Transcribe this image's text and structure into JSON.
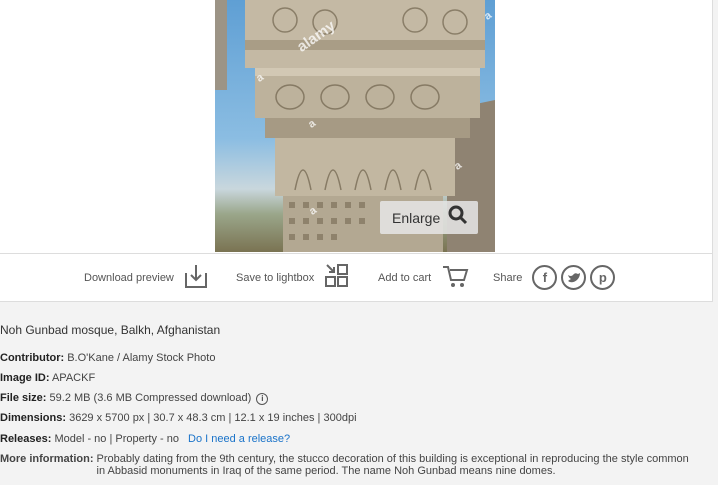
{
  "image": {
    "alt": "",
    "watermarks": [
      "alamy",
      "a",
      "a",
      "a",
      "a",
      "a"
    ]
  },
  "enlarge_label": "Enlarge",
  "actions": {
    "download_preview": "Download preview",
    "save_to_lightbox": "Save to lightbox",
    "add_to_cart": "Add to cart",
    "share": "Share",
    "share_icons": [
      "facebook-icon",
      "twitter-icon",
      "pinterest-icon"
    ]
  },
  "details": {
    "title": "Noh Gunbad mosque, Balkh, Afghanistan",
    "contributor_label": "Contributor:",
    "contributor": "B.O'Kane / Alamy Stock Photo",
    "image_id_label": "Image ID:",
    "image_id": "APACKF",
    "file_size_label": "File size:",
    "file_size": "59.2 MB (3.6 MB Compressed download)",
    "dimensions_label": "Dimensions:",
    "dimensions": "3629 x 5700 px | 30.7 x 48.3 cm | 12.1 x 19 inches | 300dpi",
    "releases_label": "Releases:",
    "releases": "Model - no | Property - no",
    "release_link": "Do I need a release?",
    "more_info_label": "More information:",
    "more_info": "Probably dating from the 9th century, the stucco decoration of this building is exceptional in reproducing the style common in Abbasid monuments in Iraq of the same period. The name Noh Gunbad means nine domes."
  },
  "colors": {
    "link": "#1a73c9",
    "sky": "#5f9fd4",
    "stone": "#b5aa95"
  }
}
